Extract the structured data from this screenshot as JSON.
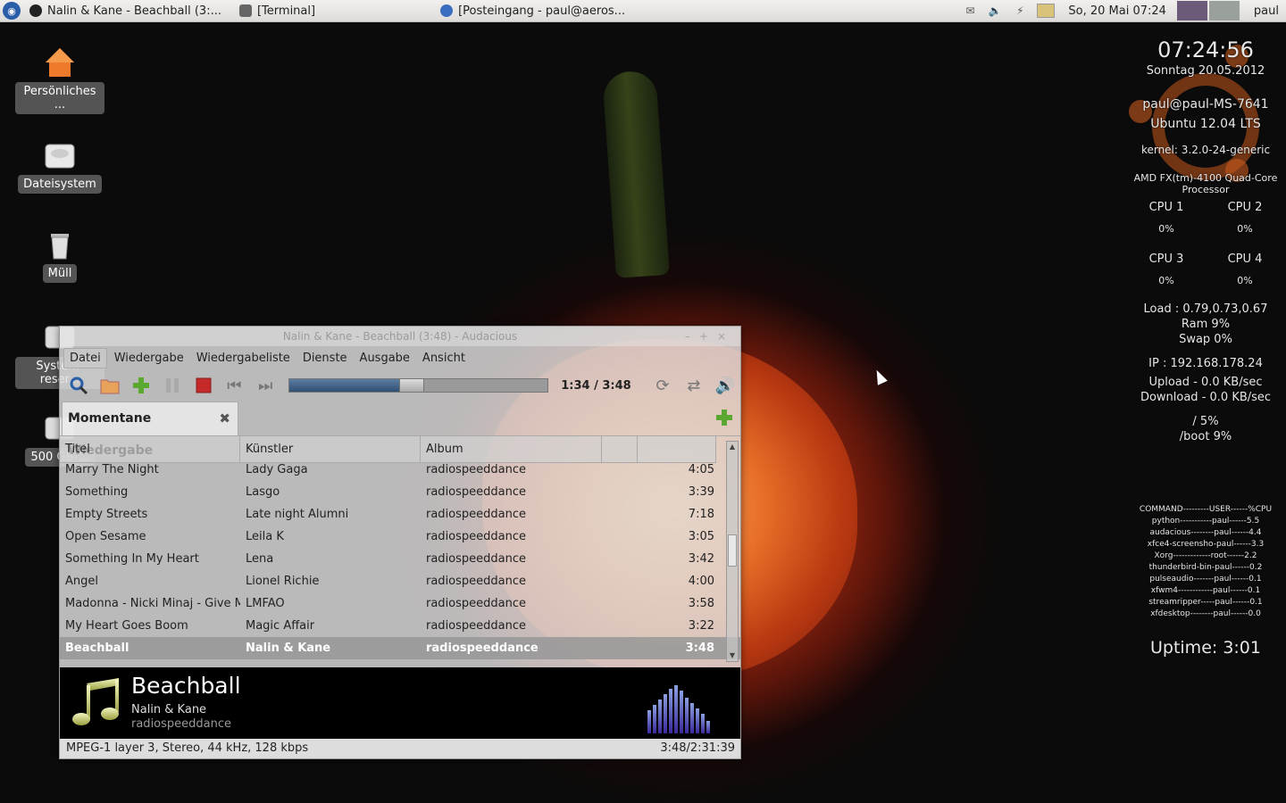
{
  "panel": {
    "tasks": [
      {
        "label": "Nalin & Kane - Beachball (3:...",
        "color": "#222222"
      },
      {
        "label": "[Terminal]",
        "color": "#666666"
      },
      {
        "label": "[Posteingang - paul@aeros...",
        "color": "#3a6fbf"
      }
    ],
    "datetime": "So, 20 Mai  07:24",
    "user": "paul"
  },
  "desktop": {
    "icons": [
      {
        "label": "Persönliches ...",
        "kind": "home-icon"
      },
      {
        "label": "Dateisystem",
        "kind": "drive-icon"
      },
      {
        "label": "Müll",
        "kind": "trash-icon"
      },
      {
        "label": "System-reser...",
        "kind": "drive-icon"
      },
      {
        "label": "500 GB-...",
        "kind": "drive-icon"
      }
    ]
  },
  "conky": {
    "time": "07:24:56",
    "date": "Sonntag 20.05.2012",
    "host": "paul@paul-MS-7641",
    "os": "Ubuntu 12.04 LTS",
    "kernel": "kernel: 3.2.0-24-generic",
    "processor": "AMD FX(tm)-4100 Quad-Core Processor",
    "cpus": [
      {
        "name": "CPU 1",
        "value": "0%"
      },
      {
        "name": "CPU 2",
        "value": "0%"
      },
      {
        "name": "CPU 3",
        "value": "0%"
      },
      {
        "name": "CPU 4",
        "value": "0%"
      }
    ],
    "load": "Load : 0.79,0.73,0.67",
    "ram": "Ram 9%",
    "swap": "Swap 0%",
    "ip": "IP : 192.168.178.24",
    "upload": "Upload - 0.0 KB/sec",
    "download": "Download - 0.0 KB/sec",
    "disk_root": "/ 5%",
    "disk_boot": "/boot 9%",
    "proc_header": "COMMAND---------USER------%CPU",
    "procs": [
      "python-----------paul------5.5",
      "audacious--------paul------4.4",
      "xfce4-screensho-paul------3.3",
      "Xorg-------------root------2.2",
      "thunderbird-bin-paul------0.2",
      "pulseaudio-------paul------0.1",
      "xfwm4------------paul------0.1",
      "streamripper-----paul------0.1",
      "xfdesktop--------paul------0.0"
    ],
    "uptime": "Uptime: 3:01"
  },
  "player": {
    "title": "Nalin & Kane - Beachball (3:48) - Audacious",
    "menu": [
      "Datei",
      "Wiedergabe",
      "Wiedergabeliste",
      "Dienste",
      "Ausgabe",
      "Ansicht"
    ],
    "time": "1:34 / 3:48",
    "progress": 0.41,
    "tab_label": "Momentane Wiedergabe",
    "columns": [
      "Titel",
      "Künstler",
      "Album",
      "",
      ""
    ],
    "rows": [
      {
        "title": "Marry The Night",
        "artist": "Lady Gaga",
        "album": "radiospeeddance",
        "length": "4:05"
      },
      {
        "title": "Something",
        "artist": "Lasgo",
        "album": "radiospeeddance",
        "length": "3:39"
      },
      {
        "title": "Empty Streets",
        "artist": "Late night Alumni",
        "album": "radiospeeddance",
        "length": "7:18"
      },
      {
        "title": "Open Sesame",
        "artist": "Leila K",
        "album": "radiospeeddance",
        "length": "3:05"
      },
      {
        "title": "Something In My Heart",
        "artist": "Lena",
        "album": "radiospeeddance",
        "length": "3:42"
      },
      {
        "title": "Angel",
        "artist": "Lionel Richie",
        "album": "radiospeeddance",
        "length": "4:00"
      },
      {
        "title": "Madonna - Nicki Minaj - Give M...",
        "artist": "LMFAO",
        "album": "radiospeeddance",
        "length": "3:58"
      },
      {
        "title": "My Heart Goes Boom",
        "artist": "Magic Affair",
        "album": "radiospeeddance",
        "length": "3:22"
      },
      {
        "title": "Beachball",
        "artist": "Nalin & Kane",
        "album": "radiospeeddance",
        "length": "3:48"
      }
    ],
    "now": {
      "title": "Beachball",
      "artist": "Nalin & Kane",
      "album": "radiospeeddance"
    },
    "status_left": "MPEG-1 layer 3, Stereo, 44 kHz, 128 kbps",
    "status_right": "3:48/2:31:39"
  }
}
